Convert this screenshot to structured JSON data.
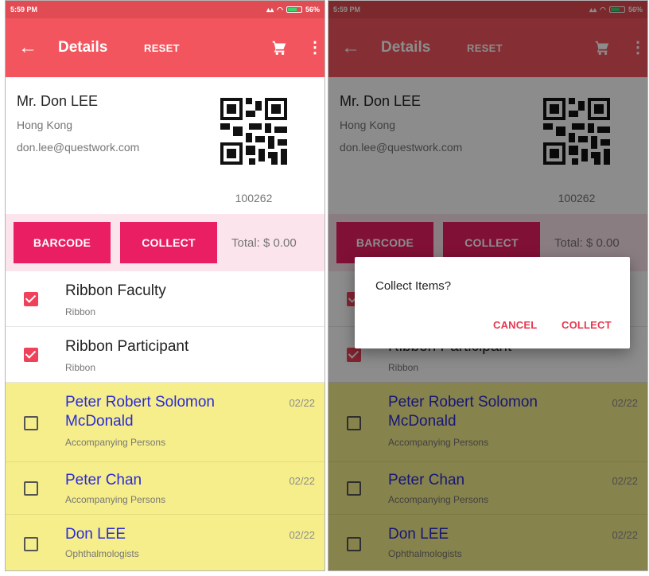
{
  "status_bar": {
    "time": "5:59 PM",
    "battery": "56%"
  },
  "app_bar": {
    "title": "Details",
    "reset_label": "RESET"
  },
  "profile": {
    "name": "Mr. Don LEE",
    "location": "Hong Kong",
    "email": "don.lee@questwork.com",
    "qr_number": "100262"
  },
  "actions": {
    "barcode_label": "BARCODE",
    "collect_label": "COLLECT",
    "total": "Total: $ 0.00"
  },
  "items": [
    {
      "title": "Ribbon Faculty",
      "subtitle": "Ribbon",
      "checked": true,
      "date": ""
    },
    {
      "title": "Ribbon Participant",
      "subtitle": "Ribbon",
      "checked": true,
      "date": ""
    },
    {
      "title": "Peter Robert Solomon McDonald",
      "title_line1": "Peter Robert Solomon",
      "title_line2": "McDonald",
      "subtitle": "Accompanying Persons",
      "checked": false,
      "date": "02/22"
    },
    {
      "title": "Peter Chan",
      "subtitle": "Accompanying Persons",
      "checked": false,
      "date": "02/22"
    },
    {
      "title": "Don LEE",
      "subtitle": "Ophthalmologists",
      "checked": false,
      "date": "02/22"
    }
  ],
  "dialog": {
    "title": "Collect Items?",
    "cancel_label": "CANCEL",
    "confirm_label": "COLLECT"
  },
  "colors": {
    "status_bar": "#e14b53",
    "app_bar": "#f2555d",
    "action_band": "#fce4ec",
    "primary_button": "#e91e63",
    "checked_box": "#f0415a",
    "highlight_row": "#f6ee8a",
    "link_blue": "#2a2ad8"
  },
  "icons": [
    "back-arrow-icon",
    "cart-icon",
    "more-vert-icon",
    "qr-code-icon",
    "checkbox-checked-icon",
    "checkbox-unchecked-icon"
  ]
}
